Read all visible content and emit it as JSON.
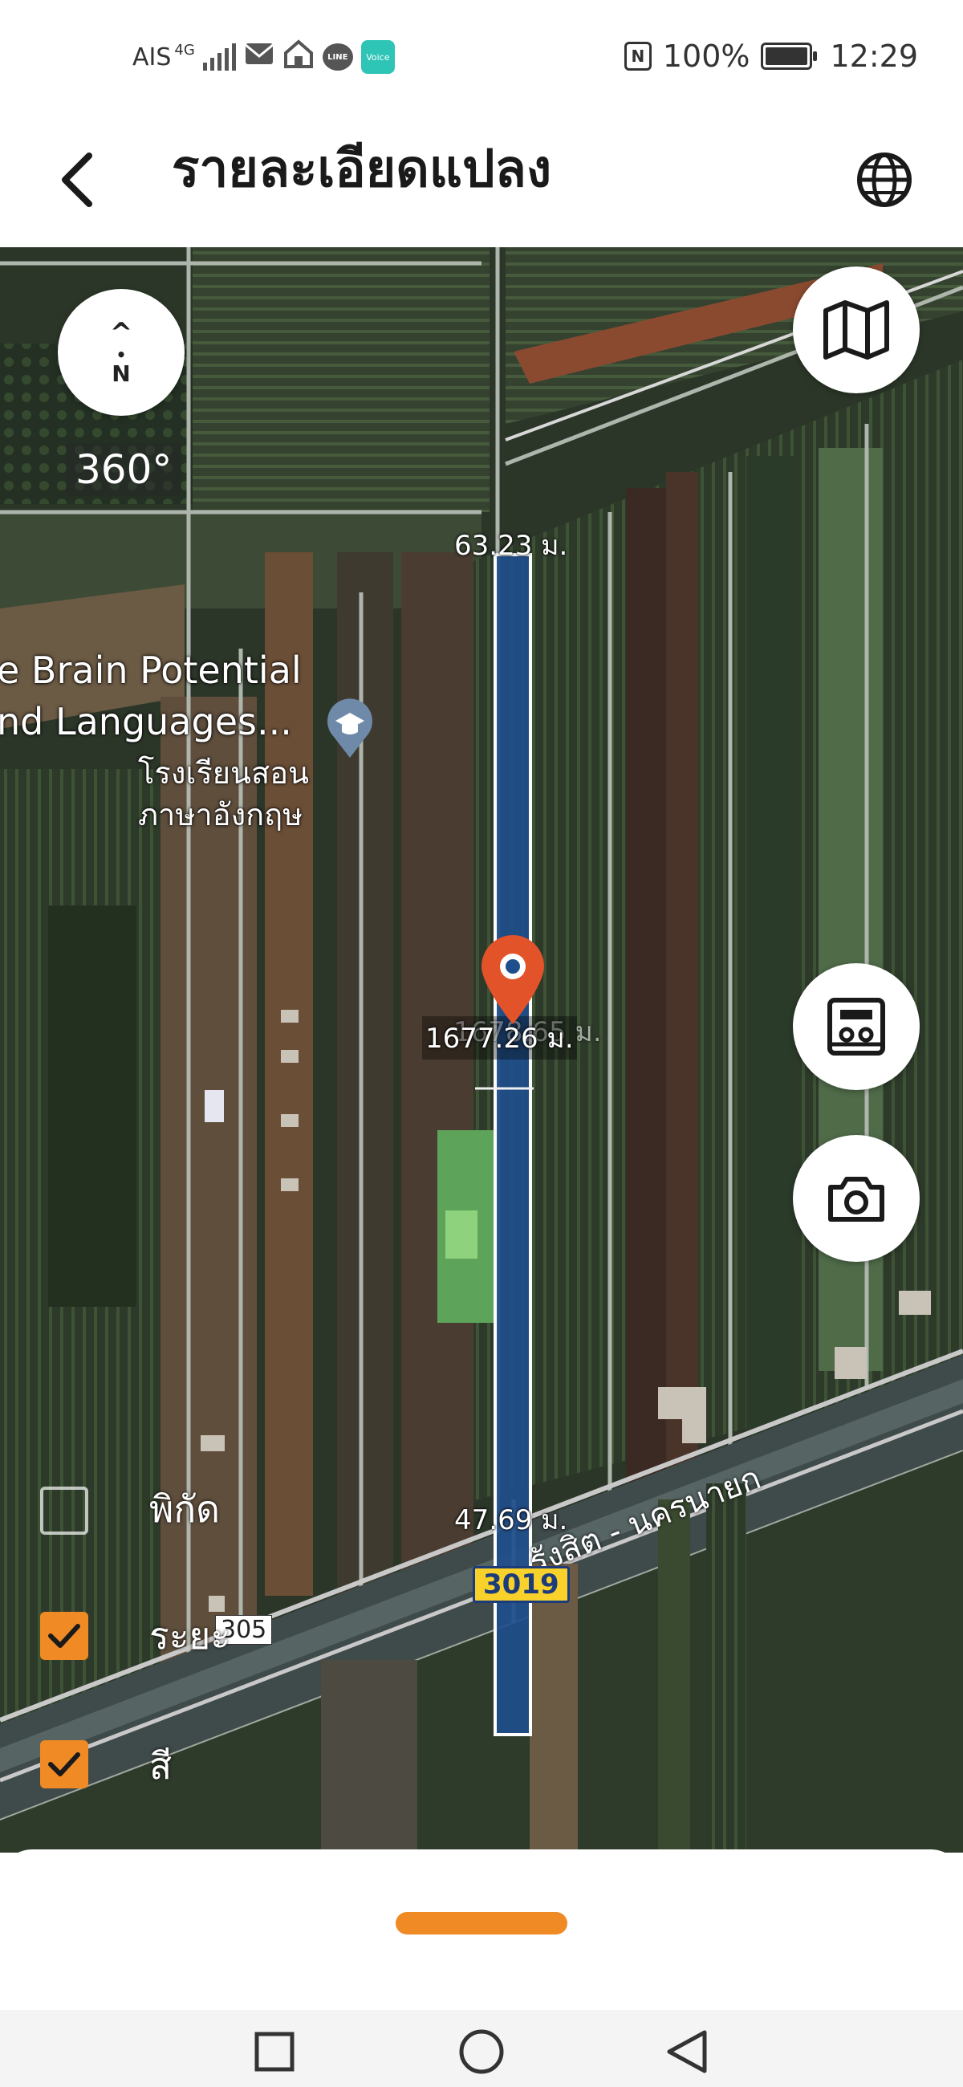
{
  "status_bar": {
    "carrier": "AIS",
    "network": "4G",
    "line_icon_text": "LINE",
    "voice_icon_text": "Voice",
    "nfc_icon_text": "N",
    "battery_percent": "100%",
    "time": "12:29",
    "icons": [
      "signal-icon",
      "mail-icon",
      "home-icon",
      "line-icon",
      "voice-app-icon",
      "nfc-icon",
      "battery-icon"
    ]
  },
  "header": {
    "title": "รายละเอียดแปลง",
    "back_icon": "chevron-left-icon",
    "language_icon": "globe-icon"
  },
  "map": {
    "compass": {
      "arrow": "^",
      "letter": "N"
    },
    "rotation_label": "360°",
    "measurements": {
      "top": "63.23 ม.",
      "middle": "1677.26 ม.",
      "middle_overlap": "1678.65 ม.",
      "bottom": "47.69 ม."
    },
    "poi": {
      "name_en_line1": "e Brain Potential",
      "name_en_line2": "nd Languages...",
      "name_th_line1": "โรงเรียนสอน",
      "name_th_line2": "ภาษาอังกฤษ",
      "icon": "graduation-cap-icon"
    },
    "road_name": "รังสิต - นครนายก",
    "road_shield": "3019",
    "road_number_small": "305",
    "layers": [
      {
        "label": "พิกัด",
        "checked": false
      },
      {
        "label": "ระยะ",
        "checked": true
      },
      {
        "label": "สี",
        "checked": true
      }
    ],
    "tools": [
      "map-icon",
      "calculator-icon",
      "camera-icon"
    ],
    "colors": {
      "parcel_fill": "#1f4e8c",
      "accent": "#f08a24",
      "pin": "#e2532a"
    }
  },
  "nav": {
    "buttons": [
      "recent-apps-icon",
      "home-circle-icon",
      "back-triangle-icon"
    ]
  }
}
